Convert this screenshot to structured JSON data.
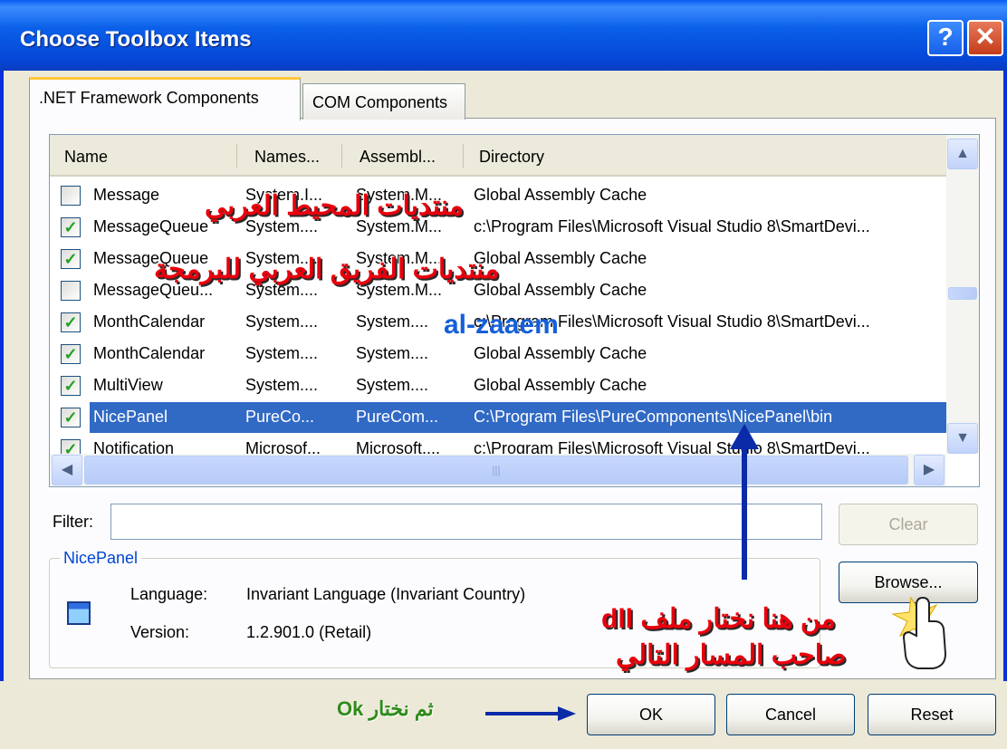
{
  "window": {
    "title": "Choose Toolbox Items",
    "help_glyph": "?",
    "close_glyph": "✕"
  },
  "tabs": [
    {
      "label": ".NET Framework Components",
      "active": true
    },
    {
      "label": "COM Components",
      "active": false
    }
  ],
  "list": {
    "columns": [
      "Name",
      "Names...",
      "Assembl...",
      "Directory"
    ],
    "rows": [
      {
        "checked": false,
        "name": "Message",
        "namespace": "System.I...",
        "assembly": "System.M...",
        "directory": "Global Assembly Cache"
      },
      {
        "checked": true,
        "name": "MessageQueue",
        "namespace": "System....",
        "assembly": "System.M...",
        "directory": "c:\\Program Files\\Microsoft Visual Studio 8\\SmartDevi..."
      },
      {
        "checked": true,
        "name": "MessageQueue",
        "namespace": "System....",
        "assembly": "System.M...",
        "directory": "Global Assembly Cache"
      },
      {
        "checked": false,
        "name": "MessageQueu...",
        "namespace": "System....",
        "assembly": "System.M...",
        "directory": "Global Assembly Cache"
      },
      {
        "checked": true,
        "name": "MonthCalendar",
        "namespace": "System....",
        "assembly": "System....",
        "directory": "c:\\Program Files\\Microsoft Visual Studio 8\\SmartDevi..."
      },
      {
        "checked": true,
        "name": "MonthCalendar",
        "namespace": "System....",
        "assembly": "System....",
        "directory": "Global Assembly Cache"
      },
      {
        "checked": true,
        "name": "MultiView",
        "namespace": "System....",
        "assembly": "System....",
        "directory": "Global Assembly Cache"
      },
      {
        "checked": true,
        "name": "NicePanel",
        "namespace": "PureCo...",
        "assembly": "PureCom...",
        "directory": "C:\\Program Files\\PureComponents\\NicePanel\\bin",
        "selected": true
      },
      {
        "checked": true,
        "name": "Notification",
        "namespace": "Microsof...",
        "assembly": "Microsoft....",
        "directory": "c:\\Program Files\\Microsoft Visual Studio 8\\SmartDevi..."
      }
    ]
  },
  "filter": {
    "label": "Filter:",
    "value": "",
    "clear_label": "Clear"
  },
  "details": {
    "group_title": "NicePanel",
    "language_label": "Language:",
    "language_value": "Invariant Language (Invariant Country)",
    "version_label": "Version:",
    "version_value": "1.2.901.0 (Retail)"
  },
  "buttons": {
    "browse": "Browse...",
    "ok": "OK",
    "cancel": "Cancel",
    "reset": "Reset"
  },
  "annotations": {
    "forum1": "منتديات المحيط العربي",
    "forum2": "منتديات الفريق العربي للبرمجة",
    "author": "al-zaaem",
    "instruction_line1": "dll من هنا نختار ملف",
    "instruction_line2": "صاحب المسار التالي",
    "ok_hint": "Ok ثم نختار"
  },
  "colors": {
    "title_bar": "#0a5fe8",
    "selection": "#316ac5",
    "annotation_red": "#e8000d",
    "annotation_blue": "#1560d8",
    "annotation_green": "#2e8b1a"
  }
}
